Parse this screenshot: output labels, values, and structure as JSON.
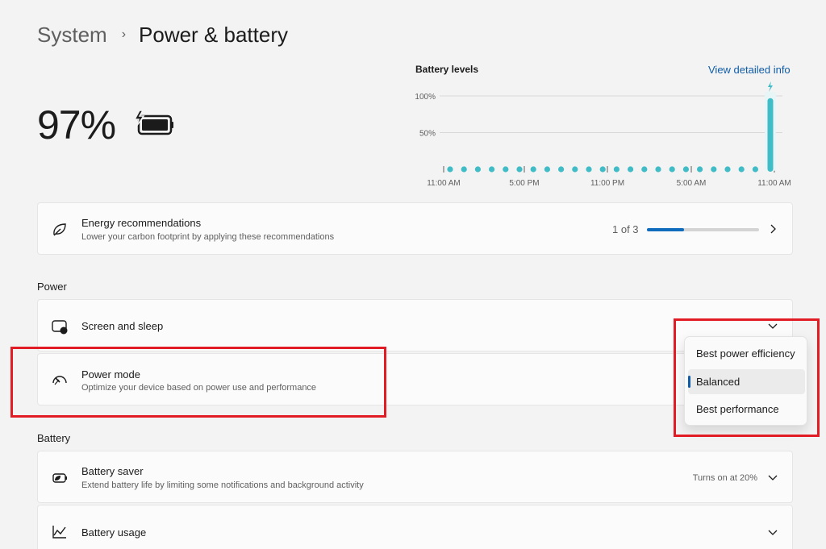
{
  "breadcrumb": {
    "parent": "System",
    "separator": "›",
    "current": "Power & battery"
  },
  "battery": {
    "percent": "97%",
    "icon": "battery-charging-icon"
  },
  "battery_chart": {
    "title": "Battery levels",
    "link": "View detailed info",
    "y_labels": [
      "100%",
      "50%"
    ],
    "x_labels": [
      "11:00 AM",
      "5:00 PM",
      "11:00 PM",
      "5:00 AM",
      "11:00 AM"
    ],
    "charging_icon": "lightning-icon",
    "current_level_percent": 97,
    "color": "#3fbcc6"
  },
  "energy_card": {
    "icon": "leaf-icon",
    "title": "Energy recommendations",
    "subtitle": "Lower your carbon footprint by applying these recommendations",
    "count": "1 of 3",
    "progress_fraction": 0.33
  },
  "power_section": {
    "label": "Power"
  },
  "screen_sleep": {
    "icon": "screen-moon-icon",
    "title": "Screen and sleep"
  },
  "power_mode": {
    "icon": "gauge-icon",
    "title": "Power mode",
    "subtitle": "Optimize your device based on power use and performance",
    "options": [
      "Best power efficiency",
      "Balanced",
      "Best performance"
    ],
    "selected": "Balanced"
  },
  "battery_section": {
    "label": "Battery"
  },
  "battery_saver": {
    "icon": "battery-saver-icon",
    "title": "Battery saver",
    "subtitle": "Extend battery life by limiting some notifications and background activity",
    "status": "Turns on at 20%"
  },
  "battery_usage": {
    "icon": "line-chart-icon",
    "title": "Battery usage"
  },
  "colors": {
    "accent": "#0f6cbd",
    "highlight": "#e21c24",
    "chart": "#3fbcc6"
  }
}
